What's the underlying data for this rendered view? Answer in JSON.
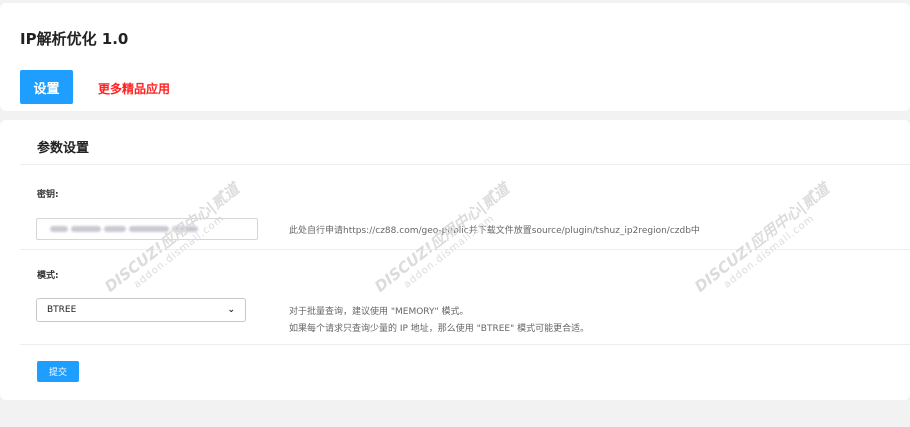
{
  "header": {
    "title": "IP解析优化 1.0",
    "settings_button": "设置",
    "more_apps_link": "更多精品应用"
  },
  "form": {
    "section_title": "参数设置",
    "key_label": "密钥:",
    "key_hint": "此处自行申请https://cz88.com/geo-public并下载文件放置source/plugin/tshuz_ip2region/czdb中",
    "mode_label": "模式:",
    "mode_value": "BTREE",
    "mode_hint_1": "对于批量查询，建议使用 \"MEMORY\" 模式。",
    "mode_hint_2": "如果每个请求只查询少量的 IP 地址，那么使用 \"BTREE\" 模式可能更合适。",
    "submit_label": "提交"
  },
  "watermark": {
    "line1": "DISCUZ!应用中心|贰道",
    "line2": "addon.dismall.com"
  },
  "colors": {
    "accent": "#1e9fff",
    "link_red": "#ff2222"
  }
}
